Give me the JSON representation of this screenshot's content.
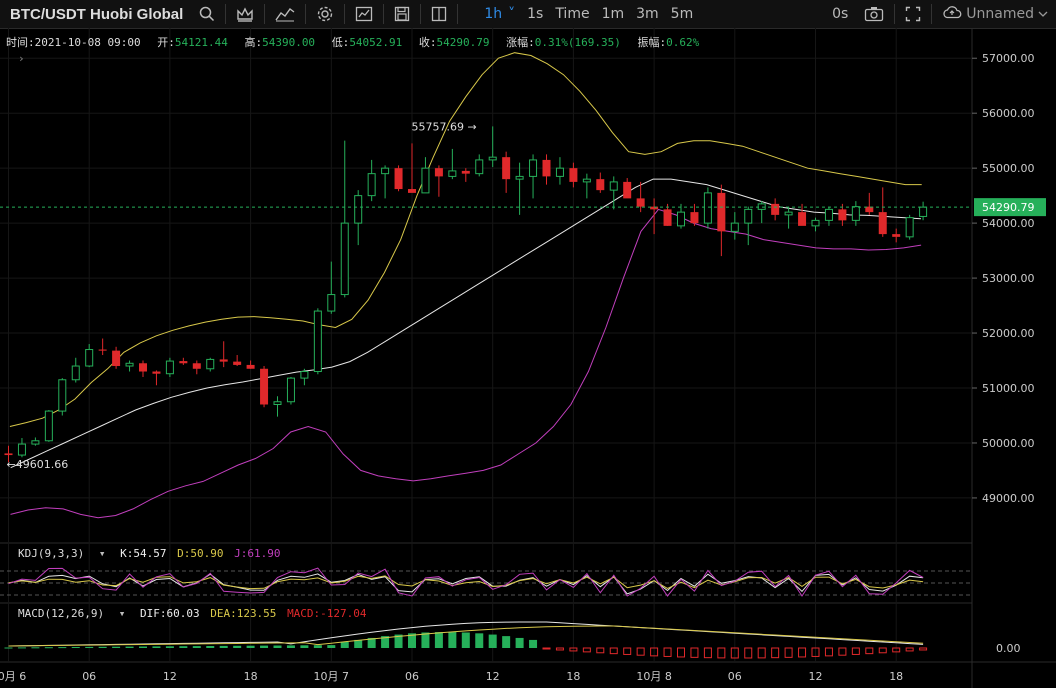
{
  "toolbar": {
    "symbol": "BTC/USDT Huobi Global",
    "timeframes": [
      "1h",
      "1s",
      "Time",
      "1m",
      "3m",
      "5m"
    ],
    "active_timeframe": "1h",
    "countdown": "0s",
    "layout_name": "Unnamed",
    "icons": [
      "search-icon",
      "crown-icon",
      "indicator-icon",
      "settings-icon",
      "chart-type-icon",
      "save-icon",
      "copy-icon",
      "camera-icon",
      "fullscreen-icon",
      "cloud-icon",
      "chevron-down-icon"
    ]
  },
  "info": {
    "time_label": "时间:",
    "time": "2021-10-08 09:00",
    "open_label": "开:",
    "open": "54121.44",
    "high_label": "高:",
    "high": "54390.00",
    "low_label": "低:",
    "low": "54052.91",
    "close_label": "收:",
    "close": "54290.79",
    "change_label": "涨幅:",
    "change": "0.31%(169.35)",
    "amp_label": "振幅:",
    "amp": "0.62%"
  },
  "kdj": {
    "title": "KDJ(9,3,3)",
    "k": "K:54.57",
    "d": "D:50.90",
    "j": "J:61.90"
  },
  "macd": {
    "title": "MACD(12,26,9)",
    "dif": "DIF:60.03",
    "dea": "DEA:123.55",
    "macd": "MACD:-127.04",
    "zero": "0.00"
  },
  "colors": {
    "up": "#26b05a",
    "down": "#e0292b",
    "upper": "#d8c84a",
    "mid": "#e6e6e6",
    "lower": "#c13fbd",
    "bg": "#000000"
  },
  "chart_data": {
    "type": "candlestick",
    "interval": "1h",
    "y_ticks": [
      49000,
      50000,
      51000,
      52000,
      53000,
      54000,
      55000,
      56000,
      57000
    ],
    "y_tick_labels": [
      "49000.00",
      "50000.00",
      "51000.00",
      "52000.00",
      "53000.00",
      "54000.00",
      "55000.00",
      "56000.00",
      "57000.00"
    ],
    "ylim": [
      48180,
      57550
    ],
    "x_tick_labels": [
      "10月 6",
      "06",
      "12",
      "18",
      "10月 7",
      "06",
      "12",
      "18",
      "10月 8",
      "06",
      "12",
      "18"
    ],
    "x_tick_hours": [
      0,
      6,
      12,
      18,
      24,
      30,
      36,
      42,
      48,
      54,
      60,
      66
    ],
    "last_price": "54290.79",
    "last_value": 54290.79,
    "max_label": "55757.69",
    "max_value": 55757.69,
    "min_label": "49601.66",
    "min_value": 49601.66,
    "candles": [
      [
        49810,
        49950,
        49650,
        49780
      ],
      [
        49780,
        50090,
        49740,
        49980
      ],
      [
        49980,
        50100,
        49950,
        50040
      ],
      [
        50040,
        50600,
        50020,
        50580
      ],
      [
        50580,
        51180,
        50500,
        51150
      ],
      [
        51150,
        51550,
        51100,
        51400
      ],
      [
        51400,
        51800,
        51380,
        51700
      ],
      [
        51700,
        51900,
        51600,
        51680
      ],
      [
        51680,
        51750,
        51350,
        51400
      ],
      [
        51400,
        51500,
        51300,
        51450
      ],
      [
        51450,
        51500,
        51200,
        51300
      ],
      [
        51300,
        51320,
        51050,
        51260
      ],
      [
        51260,
        51550,
        51200,
        51490
      ],
      [
        51490,
        51550,
        51420,
        51450
      ],
      [
        51450,
        51500,
        51250,
        51350
      ],
      [
        51350,
        51550,
        51300,
        51520
      ],
      [
        51520,
        51850,
        51380,
        51480
      ],
      [
        51480,
        51600,
        51400,
        51420
      ],
      [
        51420,
        51500,
        51350,
        51350
      ],
      [
        51350,
        51400,
        50650,
        50700
      ],
      [
        50700,
        50850,
        50480,
        50750
      ],
      [
        50750,
        51200,
        50700,
        51180
      ],
      [
        51180,
        51350,
        51050,
        51300
      ],
      [
        51300,
        52450,
        51250,
        52400
      ],
      [
        52400,
        53300,
        52350,
        52700
      ],
      [
        52700,
        55500,
        52650,
        54000
      ],
      [
        54000,
        54600,
        53600,
        54500
      ],
      [
        54500,
        55150,
        54400,
        54900
      ],
      [
        54900,
        55050,
        54450,
        55000
      ],
      [
        55000,
        55050,
        54580,
        54620
      ],
      [
        54620,
        55450,
        54560,
        54550
      ],
      [
        54550,
        55200,
        54550,
        55000
      ],
      [
        55000,
        55050,
        54480,
        54850
      ],
      [
        54850,
        55350,
        54800,
        54950
      ],
      [
        54950,
        55000,
        54750,
        54900
      ],
      [
        54900,
        55250,
        54850,
        55150
      ],
      [
        55150,
        55760,
        55020,
        55200
      ],
      [
        55200,
        55300,
        54550,
        54800
      ],
      [
        54800,
        55100,
        54150,
        54850
      ],
      [
        54850,
        55250,
        54450,
        55150
      ],
      [
        55150,
        55250,
        54700,
        54850
      ],
      [
        54850,
        55200,
        54700,
        55000
      ],
      [
        55000,
        55100,
        54650,
        54750
      ],
      [
        54750,
        54900,
        54450,
        54800
      ],
      [
        54800,
        54920,
        54550,
        54600
      ],
      [
        54600,
        54850,
        54250,
        54750
      ],
      [
        54750,
        54820,
        54500,
        54450
      ],
      [
        54450,
        54750,
        54200,
        54300
      ],
      [
        54300,
        54450,
        53800,
        54250
      ],
      [
        54250,
        54350,
        53950,
        53950
      ],
      [
        53950,
        54350,
        53900,
        54200
      ],
      [
        54200,
        54350,
        53950,
        54000
      ],
      [
        54000,
        54650,
        53900,
        54550
      ],
      [
        54550,
        54700,
        53400,
        53850
      ],
      [
        53850,
        54200,
        53700,
        54000
      ],
      [
        54000,
        54300,
        53600,
        54250
      ],
      [
        54250,
        54400,
        54000,
        54350
      ],
      [
        54350,
        54450,
        54050,
        54150
      ],
      [
        54150,
        54300,
        53900,
        54200
      ],
      [
        54200,
        54350,
        54000,
        53950
      ],
      [
        53950,
        54100,
        53850,
        54050
      ],
      [
        54050,
        54300,
        53950,
        54250
      ],
      [
        54250,
        54350,
        53950,
        54050
      ],
      [
        54050,
        54400,
        53950,
        54300
      ],
      [
        54300,
        54550,
        54150,
        54200
      ],
      [
        54200,
        54650,
        53750,
        53800
      ],
      [
        53800,
        53900,
        53650,
        53750
      ],
      [
        53750,
        54150,
        53700,
        54100
      ],
      [
        54121.44,
        54390,
        54052.91,
        54290.79
      ]
    ],
    "boll_upper": [
      50300,
      50370,
      50450,
      50600,
      50800,
      51100,
      51350,
      51650,
      51820,
      51950,
      52050,
      52130,
      52200,
      52250,
      52290,
      52300,
      52280,
      52250,
      52220,
      52150,
      52100,
      52250,
      52600,
      53100,
      53700,
      54500,
      55200,
      55850,
      56300,
      56700,
      57000,
      57100,
      57050,
      56900,
      56700,
      56400,
      56050,
      55650,
      55300,
      55250,
      55300,
      55450,
      55500,
      55500,
      55450,
      55400,
      55300,
      55200,
      55100,
      55000,
      54950,
      54900,
      54850,
      54800,
      54750,
      54700,
      54700
    ],
    "boll_mid": [
      49550,
      49700,
      49850,
      50000,
      50150,
      50300,
      50450,
      50600,
      50720,
      50830,
      50920,
      51000,
      51060,
      51110,
      51170,
      51230,
      51290,
      51330,
      51380,
      51480,
      51650,
      51850,
      52050,
      52250,
      52450,
      52650,
      52850,
      53050,
      53250,
      53450,
      53650,
      53850,
      54050,
      54250,
      54450,
      54650,
      54800,
      54800,
      54750,
      54700,
      54600,
      54500,
      54400,
      54300,
      54250,
      54200,
      54180,
      54150,
      54140,
      54120,
      54100,
      54080
    ],
    "boll_lower": [
      48700,
      48780,
      48820,
      48800,
      48700,
      48640,
      48680,
      48800,
      48970,
      49120,
      49220,
      49300,
      49450,
      49600,
      49720,
      49900,
      50200,
      50300,
      50200,
      49800,
      49500,
      49400,
      49350,
      49310,
      49350,
      49400,
      49450,
      49500,
      49600,
      49800,
      50000,
      50300,
      50700,
      51300,
      52100,
      53000,
      53850,
      54250,
      54150,
      54000,
      53900,
      53850,
      53800,
      53700,
      53650,
      53600,
      53550,
      53530,
      53530,
      53510,
      53520,
      53550,
      53600
    ]
  }
}
